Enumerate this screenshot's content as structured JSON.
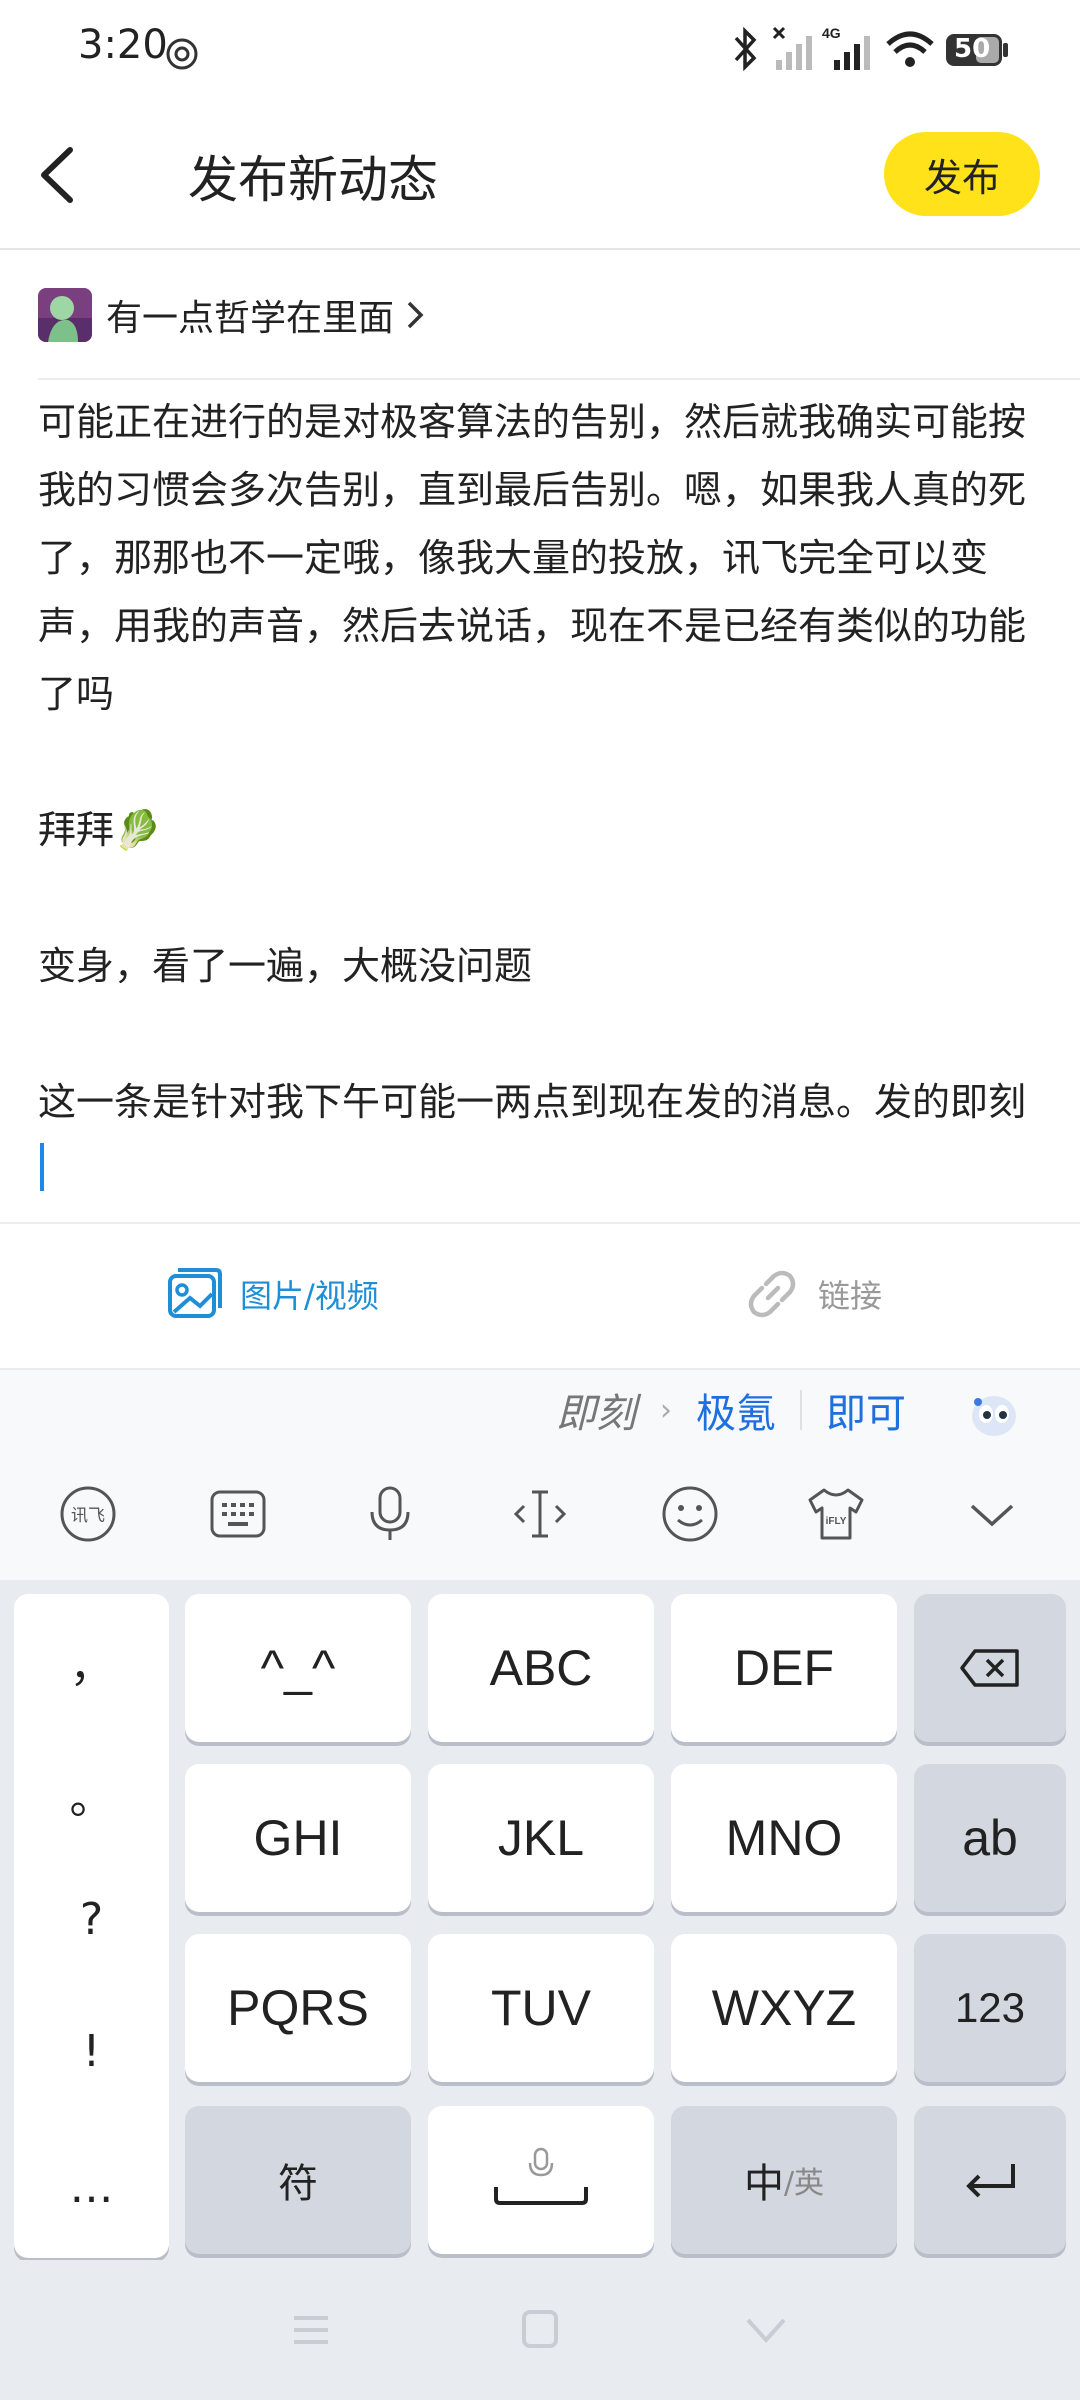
{
  "status_bar": {
    "time": "3:20",
    "battery": "50"
  },
  "header": {
    "title": "发布新动态",
    "publish_label": "发布"
  },
  "circle": {
    "name": "有一点哲学在里面"
  },
  "post": {
    "paragraphs": [
      "可能正在进行的是对极客算法的告别，然后就我确实可能按我的习惯会多次告别，直到最后告别。嗯，如果我人真的死了，那那也不一定哦，像我大量的投放，讯飞完全可以变声，用我的声音，然后去说话，现在不是已经有类似的功能了吗",
      "拜拜🥬",
      "变身，看了一遍，大概没问题",
      "这一条是针对我下午可能一两点到现在发的消息。发的即刻"
    ]
  },
  "attachments": {
    "media_label": "图片/视频",
    "link_label": "链接"
  },
  "ime": {
    "composing": "即刻",
    "candidates": [
      "极氪",
      "即可"
    ],
    "keys": {
      "row1": [
        "^_^",
        "ABC",
        "DEF"
      ],
      "row2": [
        "GHI",
        "JKL",
        "MNO"
      ],
      "row3": [
        "PQRS",
        "TUV",
        "WXYZ"
      ],
      "side_ab": "ab",
      "side_123": "123",
      "symbols": "符",
      "lang_main": "中",
      "lang_sub": "/英"
    },
    "punctuation": [
      "，",
      "。",
      "?",
      "!",
      "…"
    ]
  },
  "colors": {
    "accent_yellow": "#ffe21a",
    "link_blue": "#1e8fd6",
    "candidate_blue": "#1e6fe0"
  }
}
